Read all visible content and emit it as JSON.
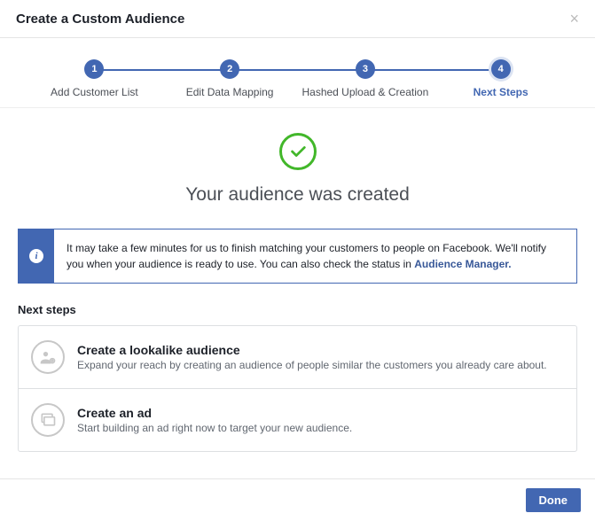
{
  "header": {
    "title": "Create a Custom Audience"
  },
  "stepper": {
    "steps": [
      {
        "num": "1",
        "label": "Add Customer List"
      },
      {
        "num": "2",
        "label": "Edit Data Mapping"
      },
      {
        "num": "3",
        "label": "Hashed Upload & Creation"
      },
      {
        "num": "4",
        "label": "Next Steps"
      }
    ]
  },
  "success": {
    "title": "Your audience was created"
  },
  "info": {
    "text": "It may take a few minutes for us to finish matching your customers to people on Facebook. We'll notify you when your audience is ready to use. You can also check the status in ",
    "link_label": "Audience Manager."
  },
  "next_steps": {
    "heading": "Next steps",
    "options": [
      {
        "title": "Create a lookalike audience",
        "desc": "Expand your reach by creating an audience of people similar the customers you already care about."
      },
      {
        "title": "Create an ad",
        "desc": "Start building an ad right now to target your new audience."
      }
    ]
  },
  "footer": {
    "done_label": "Done"
  }
}
